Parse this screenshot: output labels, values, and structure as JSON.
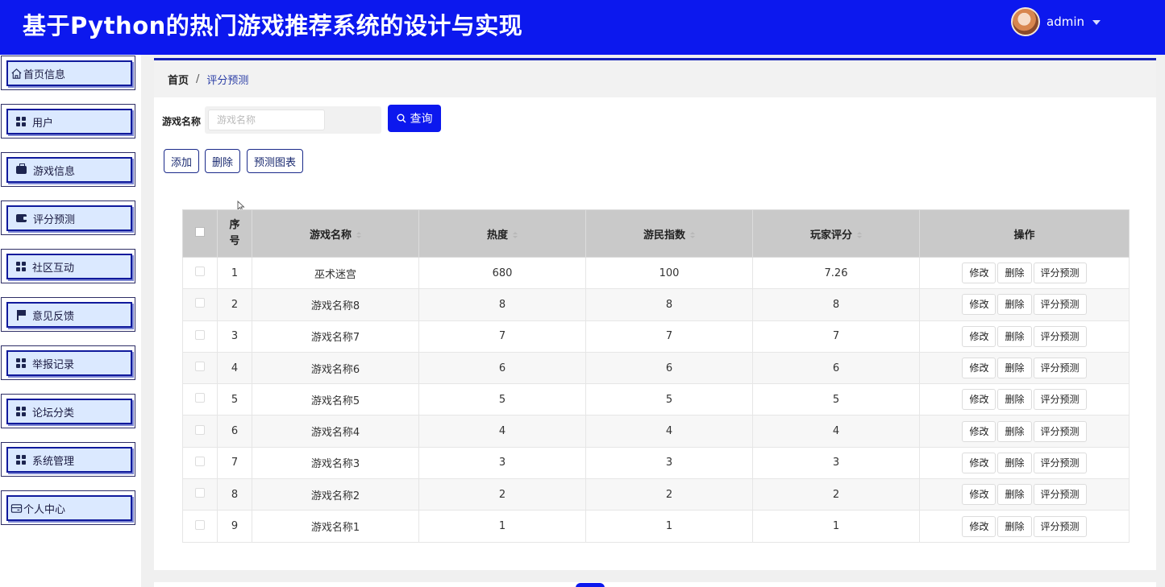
{
  "header": {
    "title": "基于Python的热门游戏推荐系统的设计与实现",
    "username": "admin"
  },
  "sidebar": {
    "items": [
      {
        "label": "首页信息",
        "icon": "home-icon"
      },
      {
        "label": "用户",
        "icon": "grid-icon"
      },
      {
        "label": "游戏信息",
        "icon": "briefcase-icon"
      },
      {
        "label": "评分预测",
        "icon": "wallet-icon"
      },
      {
        "label": "社区互动",
        "icon": "grid-icon"
      },
      {
        "label": "意见反馈",
        "icon": "flag-icon"
      },
      {
        "label": "举报记录",
        "icon": "grid-icon"
      },
      {
        "label": "论坛分类",
        "icon": "grid-icon"
      },
      {
        "label": "系统管理",
        "icon": "grid-icon"
      },
      {
        "label": "个人中心",
        "icon": "id-card-icon"
      }
    ]
  },
  "breadcrumb": {
    "home": "首页",
    "separator": "/",
    "current": "评分预测"
  },
  "search": {
    "label": "游戏名称",
    "placeholder": "游戏名称",
    "button": "查询"
  },
  "actions": {
    "add": "添加",
    "delete": "删除",
    "chart": "预测图表"
  },
  "table": {
    "columns": {
      "index": "序号",
      "name": "游戏名称",
      "heat": "热度",
      "player_index": "游民指数",
      "rating": "玩家评分",
      "ops": "操作"
    },
    "op_labels": {
      "edit": "修改",
      "delete": "删除",
      "predict": "评分预测"
    },
    "rows": [
      {
        "index": "1",
        "name": "巫术迷宫",
        "heat": "680",
        "player_index": "100",
        "rating": "7.26"
      },
      {
        "index": "2",
        "name": "游戏名称8",
        "heat": "8",
        "player_index": "8",
        "rating": "8"
      },
      {
        "index": "3",
        "name": "游戏名称7",
        "heat": "7",
        "player_index": "7",
        "rating": "7"
      },
      {
        "index": "4",
        "name": "游戏名称6",
        "heat": "6",
        "player_index": "6",
        "rating": "6"
      },
      {
        "index": "5",
        "name": "游戏名称5",
        "heat": "5",
        "player_index": "5",
        "rating": "5"
      },
      {
        "index": "6",
        "name": "游戏名称4",
        "heat": "4",
        "player_index": "4",
        "rating": "4"
      },
      {
        "index": "7",
        "name": "游戏名称3",
        "heat": "3",
        "player_index": "3",
        "rating": "3"
      },
      {
        "index": "8",
        "name": "游戏名称2",
        "heat": "2",
        "player_index": "2",
        "rating": "2"
      },
      {
        "index": "9",
        "name": "游戏名称1",
        "heat": "1",
        "player_index": "1",
        "rating": "1"
      }
    ]
  },
  "colors": {
    "primary": "#0c18ee",
    "menu_bg": "#dbe9ff",
    "table_header": "#c9c9c9"
  }
}
